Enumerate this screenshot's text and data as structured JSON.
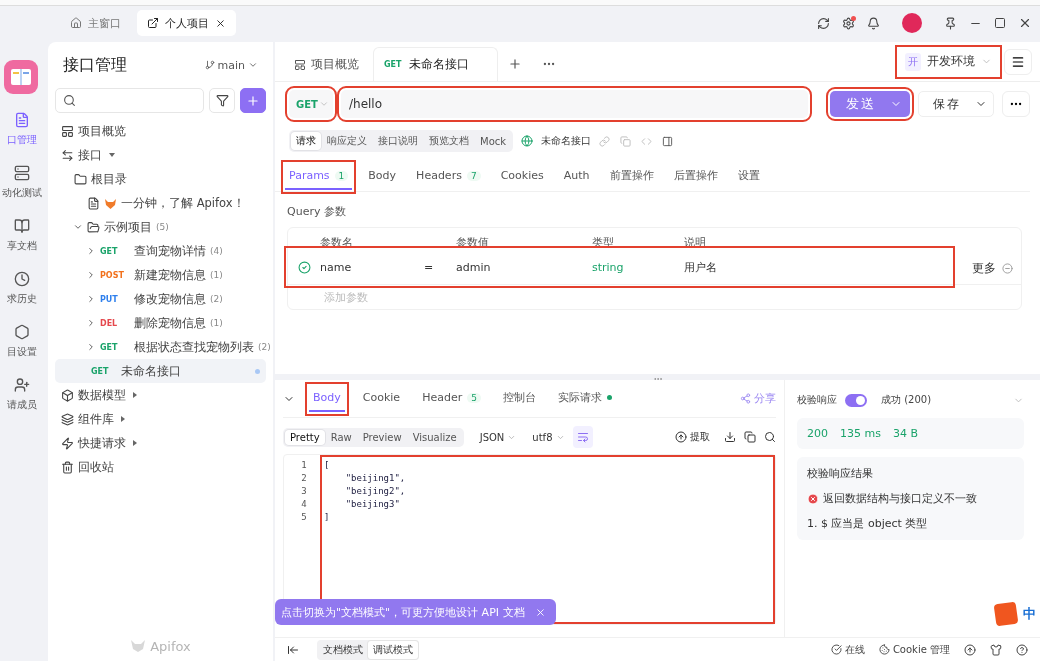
{
  "window": {
    "tabs": [
      {
        "label": "主窗口",
        "kind": "home",
        "selected": false
      },
      {
        "label": "个人项目",
        "kind": "external",
        "selected": true
      }
    ],
    "settings_alert": true
  },
  "rail": [
    {
      "label": "口管理",
      "kind": "api",
      "selected": true
    },
    {
      "label": "动化测试",
      "kind": "server",
      "selected": false
    },
    {
      "label": "享文档",
      "kind": "book",
      "selected": false
    },
    {
      "label": "求历史",
      "kind": "clock",
      "selected": false
    },
    {
      "label": "目设置",
      "kind": "hex",
      "selected": false
    },
    {
      "label": "请成员",
      "kind": "invite",
      "selected": false
    }
  ],
  "sidebar": {
    "title": "接口管理",
    "branch": "main",
    "footer_logo": "Apifox",
    "tree": [
      {
        "label": "项目概览",
        "kind": "overview"
      },
      {
        "label": "接口",
        "kind": "api",
        "expanded": true,
        "children": [
          {
            "label": "根目录",
            "kind": "root",
            "children": [
              {
                "label": "一分钟，了解 Apifox！",
                "kind": "markdown"
              },
              {
                "label": "示例项目",
                "kind": "folder",
                "count": "(5)",
                "expanded": true,
                "children": [
                  {
                    "method": "GET",
                    "color": "#1aa36a",
                    "label": "查询宠物详情",
                    "count": "(4)",
                    "expanded": false
                  },
                  {
                    "method": "POST",
                    "color": "#f2711c",
                    "label": "新建宠物信息",
                    "count": "(1)",
                    "expanded": false
                  },
                  {
                    "method": "PUT",
                    "color": "#2f80ed",
                    "label": "修改宠物信息",
                    "count": "(2)",
                    "expanded": false
                  },
                  {
                    "method": "DEL",
                    "color": "#e5484d",
                    "label": "删除宠物信息",
                    "count": "(1)",
                    "expanded": false
                  },
                  {
                    "method": "GET",
                    "color": "#1aa36a",
                    "label": "根据状态查找宠物列表",
                    "count": "(2)",
                    "expanded": false
                  }
                ]
              },
              {
                "method": "GET",
                "color": "#1aa36a",
                "label": "未命名接口",
                "selected": true,
                "unsaved": true
              }
            ]
          }
        ]
      },
      {
        "label": "数据模型",
        "kind": "model",
        "expanded": false
      },
      {
        "label": "组件库",
        "kind": "layers",
        "expanded": false
      },
      {
        "label": "快捷请求",
        "kind": "quick",
        "expanded": false
      },
      {
        "label": "回收站",
        "kind": "trash"
      }
    ]
  },
  "tabs": [
    {
      "label": "项目概览",
      "selected": false
    },
    {
      "method": "GET",
      "color": "#1aa36a",
      "label": "未命名接口",
      "selected": true
    }
  ],
  "environment": {
    "badge": "开",
    "label": "开发环境",
    "marked": true
  },
  "request": {
    "method": "GET",
    "color": "#1aa36a",
    "method_marked": true,
    "url": "/hello",
    "url_marked": true,
    "send": "发送",
    "send_marked": true,
    "save": "保存"
  },
  "views": [
    {
      "label": "请求",
      "selected": true
    },
    {
      "label": "响应定义",
      "selected": false
    },
    {
      "label": "接口说明",
      "selected": false
    },
    {
      "label": "预览文档",
      "selected": false
    },
    {
      "label": "Mock",
      "selected": false
    }
  ],
  "endpoint_name": "未命名接口",
  "param_tabs": [
    {
      "label": "Params",
      "count": "1",
      "selected": true,
      "marked": true
    },
    {
      "label": "Body",
      "selected": false
    },
    {
      "label": "Headers",
      "count": "7",
      "selected": false
    },
    {
      "label": "Cookies",
      "selected": false
    },
    {
      "label": "Auth",
      "selected": false
    },
    {
      "label": "前置操作",
      "selected": false
    },
    {
      "label": "后置操作",
      "selected": false
    },
    {
      "label": "设置",
      "selected": false
    }
  ],
  "query": {
    "title": "Query 参数",
    "columns": [
      "参数名",
      "参数值",
      "类型",
      "说明"
    ],
    "rows": [
      {
        "enabled": true,
        "name": "name",
        "operator": "=",
        "value": "admin",
        "type": "string",
        "description": "用户名",
        "more": "更多",
        "marked": true
      }
    ],
    "add_placeholder": "添加参数"
  },
  "response": {
    "tabs": [
      {
        "label": "Body",
        "selected": true,
        "marked": true
      },
      {
        "label": "Cookie",
        "selected": false
      },
      {
        "label": "Header",
        "count": "5",
        "selected": false
      },
      {
        "label": "控制台",
        "selected": false
      },
      {
        "label": "实际请求",
        "selected": false,
        "dot": true
      }
    ],
    "share": "分享",
    "formats": [
      {
        "label": "Pretty",
        "selected": true
      },
      {
        "label": "Raw",
        "selected": false
      },
      {
        "label": "Preview",
        "selected": false
      },
      {
        "label": "Visualize",
        "selected": false
      }
    ],
    "language": "JSON",
    "encoding": "utf8",
    "wrap": true,
    "extract": "提取",
    "editor_marked": true,
    "lines": [
      {
        "no": "1",
        "text": "["
      },
      {
        "no": "2",
        "text": "    \"beijing1\","
      },
      {
        "no": "3",
        "text": "    \"beijing2\","
      },
      {
        "no": "4",
        "text": "    \"beijing3\""
      },
      {
        "no": "5",
        "text": "]"
      }
    ]
  },
  "validation": {
    "label": "校验响应",
    "on": true,
    "status": "成功 (200)",
    "metrics": [
      "200",
      "135 ms",
      "34 B"
    ],
    "result_title": "校验响应结果",
    "error": "返回数据结构与接口定义不一致",
    "details": [
      "1. $ 应当是 object 类型"
    ]
  },
  "tip": {
    "text": "点击切换为\"文档模式\"，可更方便地设计 API 文档"
  },
  "modes": [
    {
      "label": "文档模式",
      "selected": false
    },
    {
      "label": "调试模式",
      "selected": true
    }
  ],
  "status": [
    {
      "label": "在线",
      "kind": "online"
    },
    {
      "label": "Cookie 管理",
      "kind": "cookie"
    }
  ],
  "ime": {
    "label": "中"
  }
}
